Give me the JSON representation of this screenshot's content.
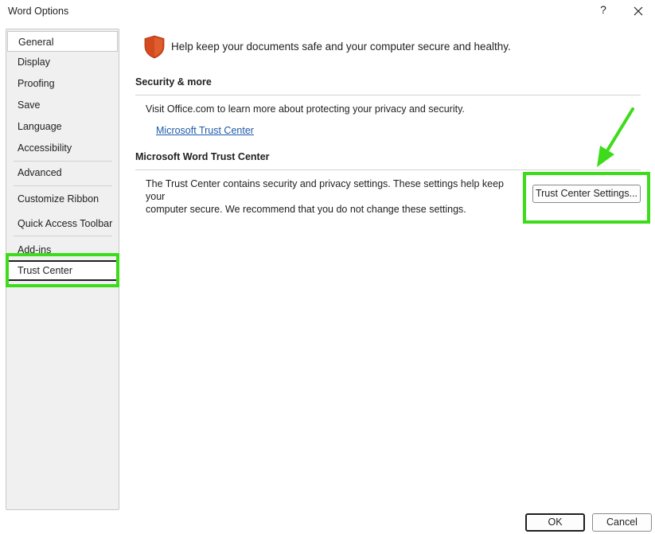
{
  "window": {
    "title": "Word Options",
    "help_label": "?",
    "close_icon": "close-icon"
  },
  "sidebar": {
    "items": [
      {
        "label": "General"
      },
      {
        "label": "Display"
      },
      {
        "label": "Proofing"
      },
      {
        "label": "Save"
      },
      {
        "label": "Language"
      },
      {
        "label": "Accessibility"
      },
      {
        "label": "Advanced"
      },
      {
        "label": "Customize Ribbon"
      },
      {
        "label": "Quick Access Toolbar"
      },
      {
        "label": "Add-ins"
      },
      {
        "label": "Trust Center"
      }
    ],
    "selected": "Trust Center"
  },
  "main": {
    "header_text": "Help keep your documents safe and your computer secure and healthy.",
    "security_section": {
      "title": "Security & more",
      "description": "Visit Office.com to learn more about protecting your privacy and security.",
      "link_label": "Microsoft Trust Center"
    },
    "trust_center_section": {
      "title": "Microsoft Word Trust Center",
      "description_line1": "The Trust Center contains security and privacy settings. These settings help keep your",
      "description_line2": "computer secure. We recommend that you do not change these settings.",
      "button_label": "Trust Center Settings..."
    }
  },
  "footer": {
    "ok_label": "OK",
    "cancel_label": "Cancel"
  },
  "colors": {
    "highlight": "#3ddc1a",
    "shield": "#d24a1e",
    "link": "#1e5aa8"
  }
}
